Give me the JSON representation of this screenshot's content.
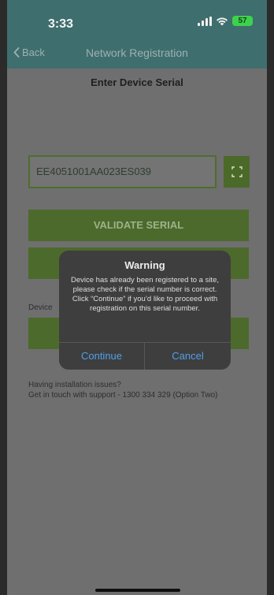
{
  "status_bar": {
    "time": "3:33",
    "battery": "57"
  },
  "nav": {
    "back_label": "Back",
    "title": "Network Registration"
  },
  "subtitle": "Enter Device Serial",
  "serial_input": {
    "value": "EE4051001AA023ES039"
  },
  "buttons": {
    "validate": "VALIDATE SERIAL"
  },
  "device_label": "Device",
  "help": {
    "line1": "Having installation issues?",
    "line2": "Get in touch with support - 1300 334 329 (Option Two)"
  },
  "dialog": {
    "title": "Warning",
    "message": "Device has already been registered to a site, please check if the serial number is correct. Click “Continue” if you’d like to proceed with registration on this serial number.",
    "continue": "Continue",
    "cancel": "Cancel"
  },
  "colors": {
    "header": "#3f6e6e",
    "button": "#4c6a2c",
    "dialog_action": "#4f9fe8"
  }
}
